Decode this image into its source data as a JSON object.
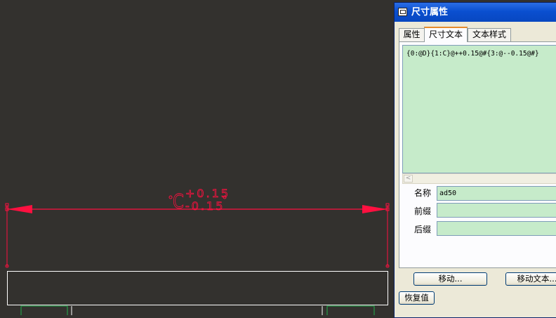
{
  "canvas": {
    "dimension_text_upper": "+0.15",
    "dimension_text_lower": "-0.15",
    "dimension_prefix": "C"
  },
  "dialog": {
    "title": "尺寸属性",
    "tabs": [
      {
        "label": "属性",
        "active": false
      },
      {
        "label": "尺寸文本",
        "active": true
      },
      {
        "label": "文本样式",
        "active": false
      }
    ],
    "dimension_text": "{0:@D}{1:C}@++0.15@#{3:@--0.15@#}",
    "fields": {
      "name_label": "名称",
      "name_value": "ad50",
      "prefix_label": "前缀",
      "prefix_value": "",
      "suffix_label": "后缀",
      "suffix_value": ""
    },
    "buttons": {
      "move": "移动...",
      "move_text": "移动文本...",
      "restore": "恢复值"
    }
  },
  "colors": {
    "background": "#33312e",
    "dimension": "#ff1040",
    "part_edge": "#ffffff",
    "hidden_edge": "#22b14c",
    "input_fill": "#c6ebca"
  }
}
